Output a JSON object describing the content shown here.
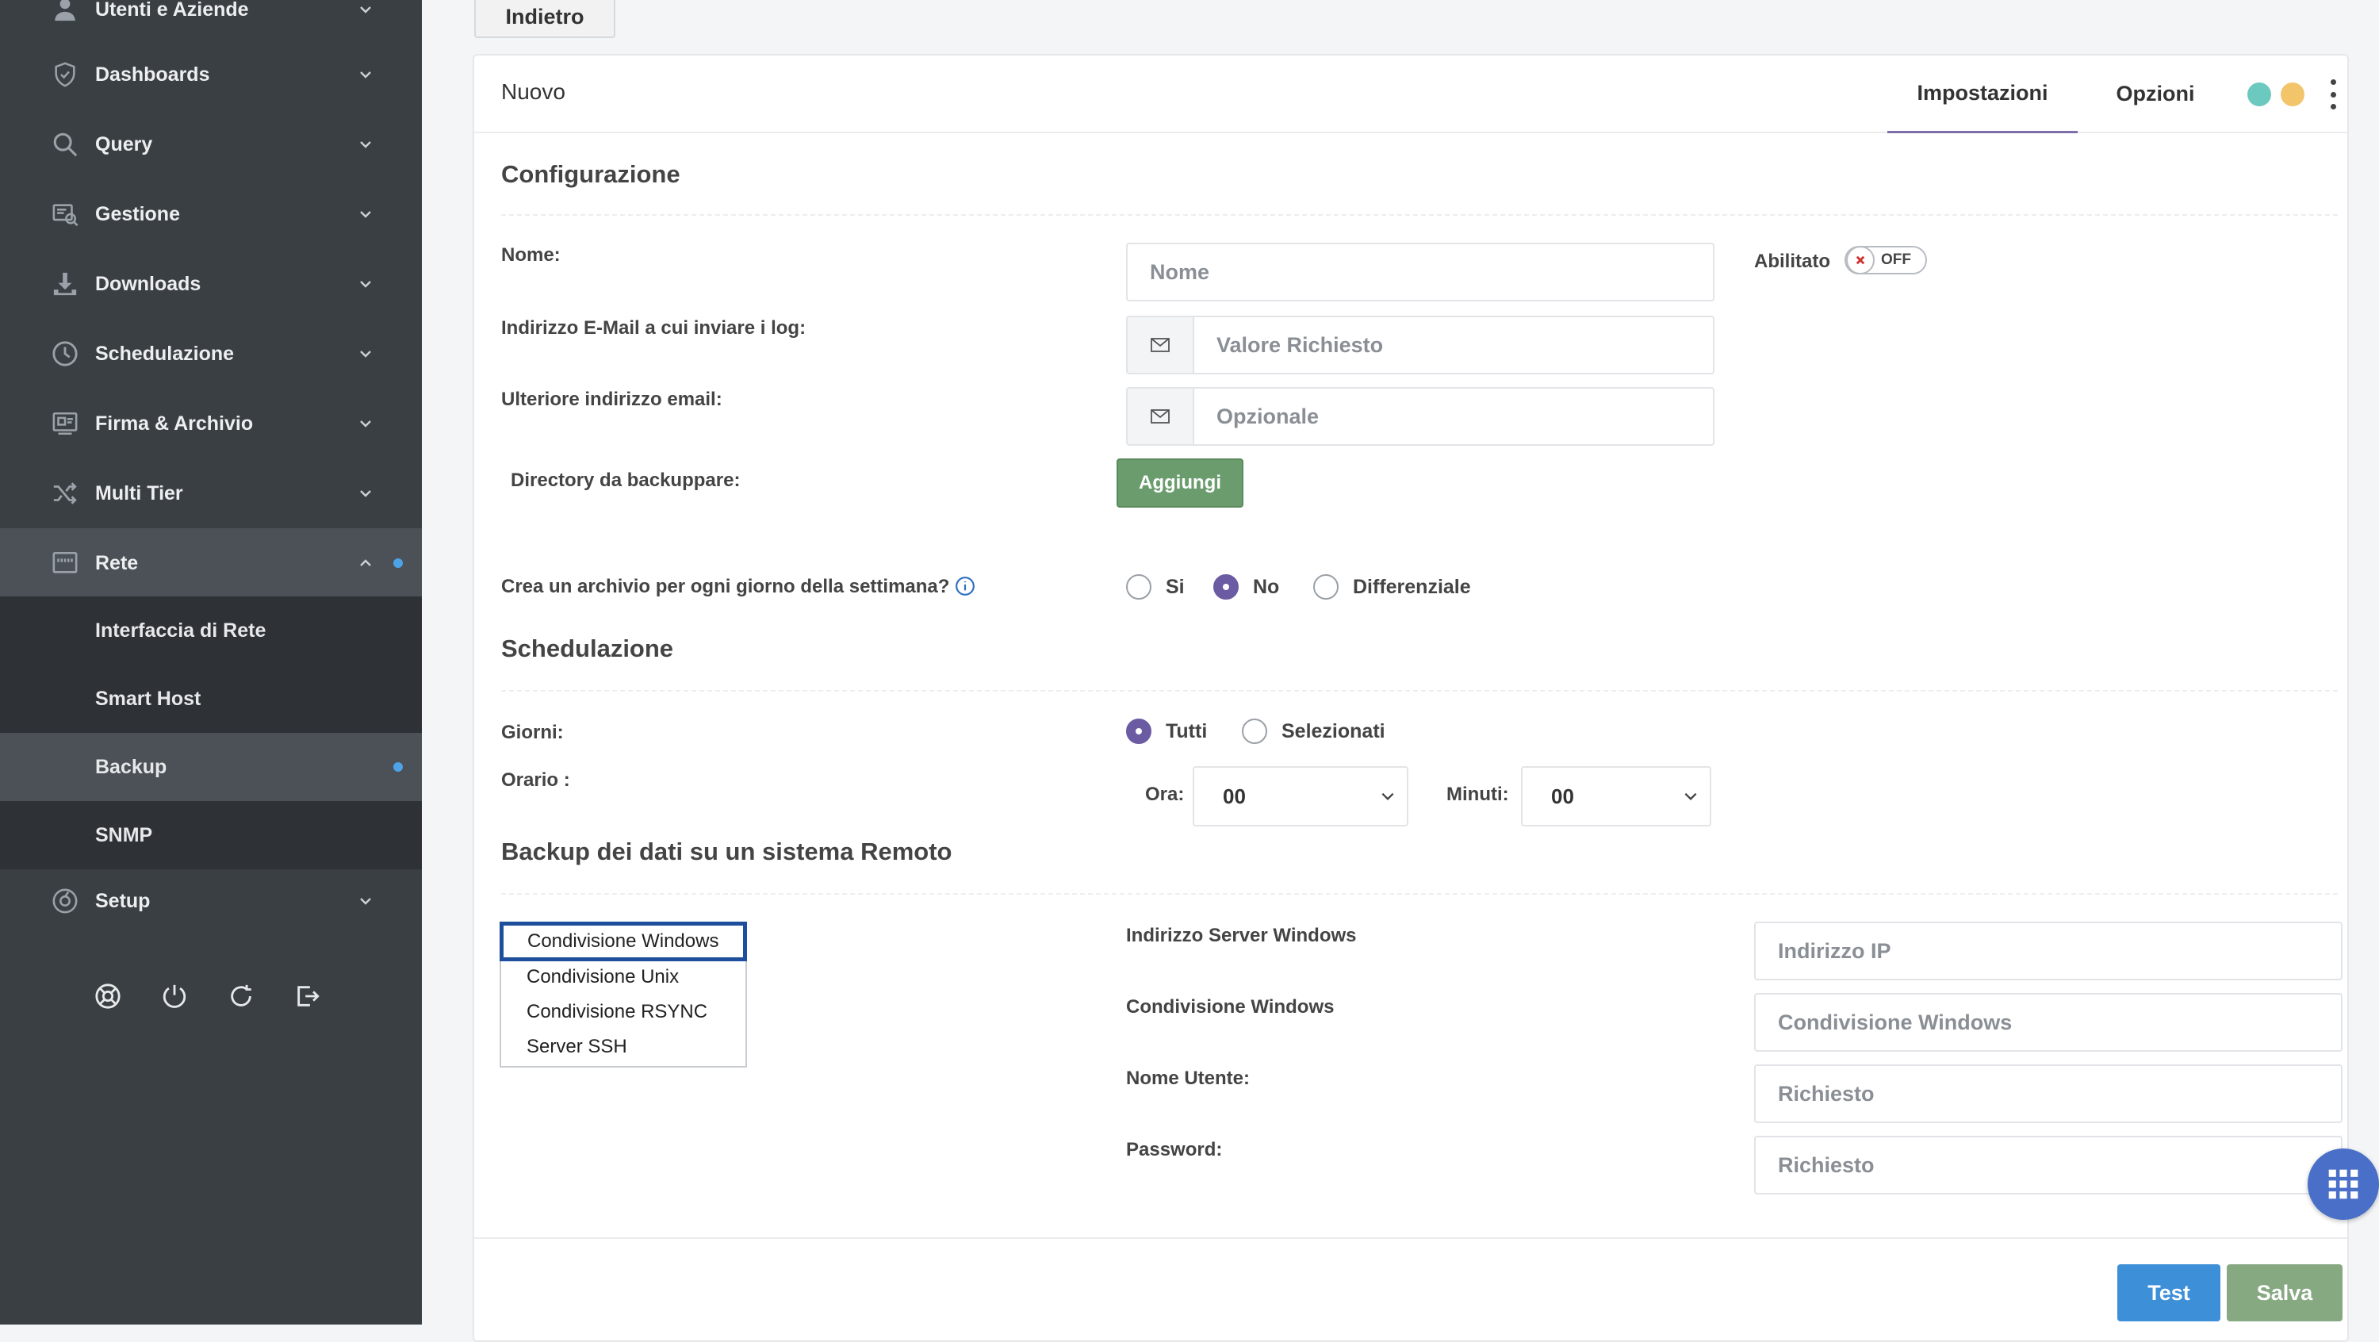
{
  "colors": {
    "sidebar_bg": "#3a3f44",
    "active_item_bg": "#4b5157",
    "accent_dot": "#4da3e6",
    "add_button": "#6b9c6d",
    "test_button": "#3d8fd8",
    "save_button": "#86a982",
    "radio_selected": "#6b5ba3",
    "status_dot_teal": "#6cc9bf",
    "status_dot_yellow": "#f3c56b",
    "fab": "#4a6fc9"
  },
  "sidebar": {
    "items": [
      {
        "label": "Utenti e Aziende",
        "icon": "user-icon"
      },
      {
        "label": "Dashboards",
        "icon": "shield-icon"
      },
      {
        "label": "Query",
        "icon": "search-icon"
      },
      {
        "label": "Gestione",
        "icon": "management-icon"
      },
      {
        "label": "Downloads",
        "icon": "download-icon"
      },
      {
        "label": "Schedulazione",
        "icon": "clock-icon"
      },
      {
        "label": "Firma & Archivio",
        "icon": "archive-icon"
      },
      {
        "label": "Multi Tier",
        "icon": "shuffle-icon"
      },
      {
        "label": "Rete",
        "icon": "network-icon",
        "expanded": true
      },
      {
        "label": "Setup",
        "icon": "setup-icon"
      }
    ],
    "rete_submenu": [
      {
        "label": "Interfaccia di Rete"
      },
      {
        "label": "Smart Host"
      },
      {
        "label": "Backup",
        "active": true
      },
      {
        "label": "SNMP"
      }
    ],
    "bottom_icons": [
      "support-icon",
      "power-icon",
      "refresh-icon",
      "logout-icon"
    ]
  },
  "back_button": "Indietro",
  "card": {
    "title": "Nuovo",
    "tabs": [
      "Impostazioni",
      "Opzioni"
    ],
    "active_tab": "Impostazioni"
  },
  "config": {
    "section_title": "Configurazione",
    "name_label": "Nome:",
    "name_placeholder": "Nome",
    "enabled_label": "Abilitato",
    "enabled_toggle": "OFF",
    "email_label": "Indirizzo E-Mail a cui inviare i log:",
    "email_placeholder": "Valore Richiesto",
    "extra_email_label": "Ulteriore indirizzo email:",
    "extra_email_placeholder": "Opzionale",
    "dir_label": "Directory da backuppare:",
    "add_button": "Aggiungi",
    "archive_question": "Crea un archivio per ogni giorno della settimana?",
    "archive_options": [
      "Si",
      "No",
      "Differenziale"
    ],
    "archive_selected": "No"
  },
  "schedule": {
    "section_title": "Schedulazione",
    "days_label": "Giorni:",
    "days_options": [
      "Tutti",
      "Selezionati"
    ],
    "days_selected": "Tutti",
    "time_label": "Orario :",
    "hour_label": "Ora:",
    "hour_value": "00",
    "minutes_label": "Minuti:",
    "minutes_value": "00"
  },
  "remote": {
    "section_title": "Backup dei dati su un sistema Remoto",
    "types": [
      "Condivisione Windows",
      "Condivisione Unix",
      "Condivisione RSYNC",
      "Server SSH"
    ],
    "selected_type": "Condivisione Windows",
    "server_label": "Indirizzo Server Windows",
    "server_placeholder": "Indirizzo IP",
    "share_label": "Condivisione Windows",
    "share_placeholder": "Condivisione Windows",
    "user_label": "Nome Utente:",
    "user_placeholder": "Richiesto",
    "password_label": "Password:",
    "password_placeholder": "Richiesto"
  },
  "footer": {
    "test_button": "Test",
    "save_button": "Salva"
  }
}
